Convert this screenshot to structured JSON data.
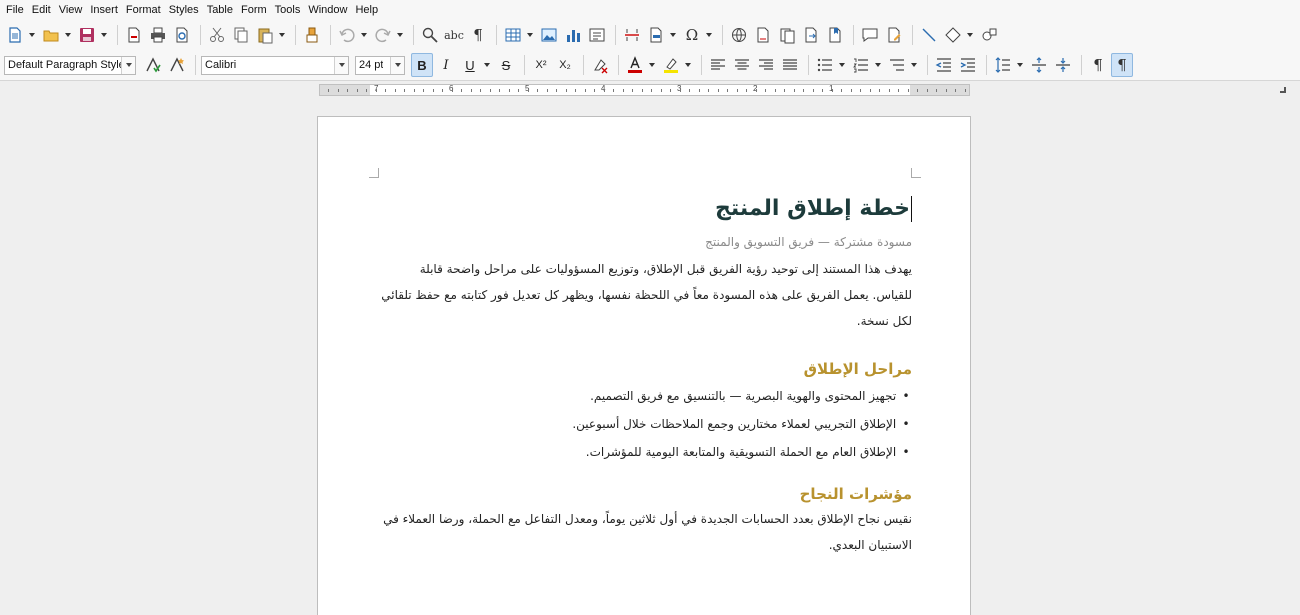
{
  "menu": [
    "File",
    "Edit",
    "View",
    "Insert",
    "Format",
    "Styles",
    "Table",
    "Form",
    "Tools",
    "Window",
    "Help"
  ],
  "toolbar": {
    "paragraph_style": "Default Paragraph Style",
    "font_name": "Calibri",
    "font_size": "24 pt",
    "bold": "B",
    "italic": "I",
    "underline": "U",
    "strike": "S",
    "superscript": "X²",
    "subscript": "X₂",
    "special_char": "Ω",
    "spelling": "abc",
    "pilcrow": "¶",
    "colors": {
      "font_color": "#cc0000",
      "highlight": "#f5e400",
      "accent": "#2b6cb0"
    }
  },
  "ruler": {
    "labels": [
      "7",
      "6",
      "5",
      "4",
      "3",
      "2",
      "1"
    ]
  },
  "document": {
    "title": "خطة إطلاق المنتج",
    "subtitle": "مسودة مشتركة — فريق التسويق والمنتج",
    "intro": "يهدف هذا المستند إلى توحيد رؤية الفريق قبل الإطلاق، وتوزيع المسؤوليات على مراحل واضحة قابلة للقياس. يعمل الفريق على هذه المسودة معاً في اللحظة نفسها، ويظهر كل تعديل فور كتابته مع حفظ تلقائي لكل نسخة.",
    "stages_heading": "مراحل الإطلاق",
    "stages": [
      "تجهيز المحتوى والهوية البصرية — بالتنسيق مع فريق التصميم.",
      "الإطلاق التجريبي لعملاء مختارين وجمع الملاحظات خلال أسبوعين.",
      "الإطلاق العام مع الحملة التسويقية والمتابعة اليومية للمؤشرات."
    ],
    "metrics_heading": "مؤشرات النجاح",
    "metrics": "نقيس نجاح الإطلاق بعدد الحسابات الجديدة في أول ثلاثين يوماً، ومعدل التفاعل مع الحملة، ورضا العملاء في الاستبيان البعدي."
  }
}
